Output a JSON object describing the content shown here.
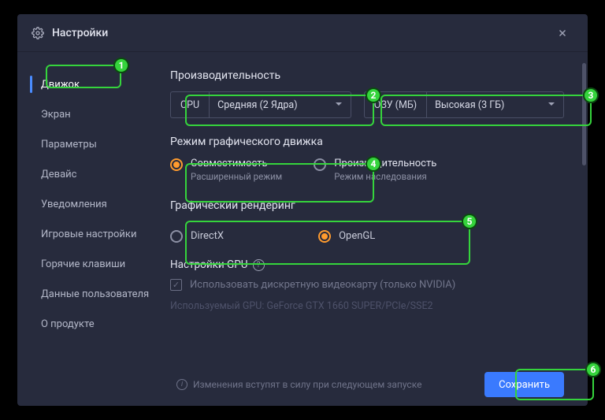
{
  "header": {
    "title": "Настройки"
  },
  "sidebar": {
    "items": [
      {
        "label": "Движок",
        "active": true
      },
      {
        "label": "Экран"
      },
      {
        "label": "Параметры"
      },
      {
        "label": "Девайс"
      },
      {
        "label": "Уведомления"
      },
      {
        "label": "Игровые настройки"
      },
      {
        "label": "Горячие клавиши"
      },
      {
        "label": "Данные пользователя"
      },
      {
        "label": "О продукте"
      }
    ]
  },
  "perf": {
    "title": "Производительность",
    "cpu": {
      "label": "CPU",
      "value": "Средняя (2 Ядра)"
    },
    "ram": {
      "label": "ОЗУ (МБ)",
      "value": "Высокая (3 ГБ)"
    }
  },
  "engineMode": {
    "title": "Режим графического движка",
    "opt1": {
      "title": "Совместимость",
      "sub": "Расширенный режим",
      "selected": true
    },
    "opt2": {
      "title": "Производительность",
      "sub": "Режим наследования",
      "selected": false
    }
  },
  "render": {
    "title": "Графический рендеринг",
    "opt1": {
      "label": "DirectX",
      "selected": false
    },
    "opt2": {
      "label": "OpenGL",
      "selected": true
    }
  },
  "gpu": {
    "title": "Настройки GPU",
    "checkbox": "Использовать дискретную видеокарту (только NVIDIA)",
    "used": "Используемый GPU: GeForce GTX 1660 SUPER/PCIe/SSE2"
  },
  "footer": {
    "note": "Изменения вступят в силу при следующем запуске",
    "save": "Сохранить"
  },
  "annotations": [
    "1",
    "2",
    "3",
    "4",
    "5",
    "6"
  ]
}
